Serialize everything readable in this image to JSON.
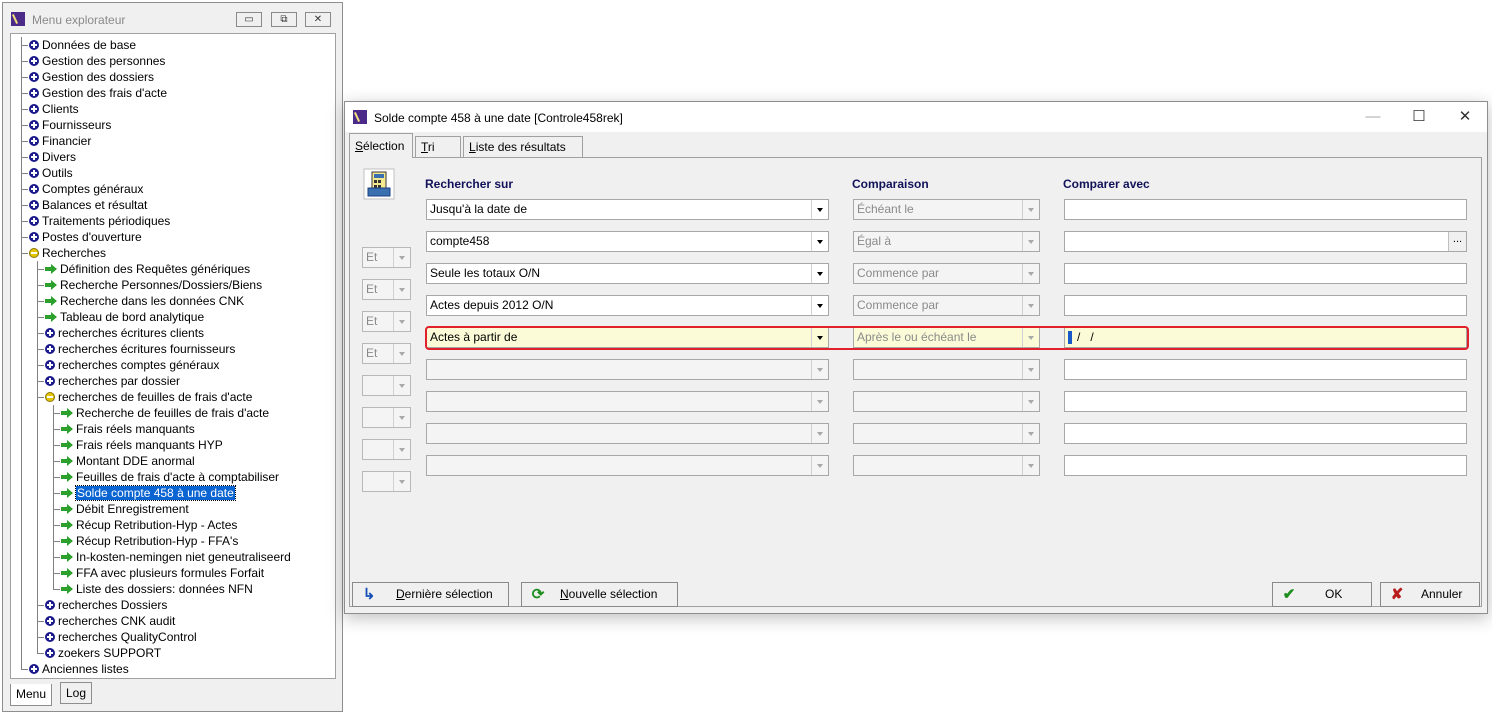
{
  "explorer": {
    "title": "Menu explorateur",
    "controls": {
      "minimize": "▭",
      "restore": "⧉",
      "close": "✕"
    },
    "tree": [
      {
        "label": "Données de base",
        "icon": "plus",
        "level": 0
      },
      {
        "label": "Gestion des personnes",
        "icon": "plus",
        "level": 0
      },
      {
        "label": "Gestion des dossiers",
        "icon": "plus",
        "level": 0
      },
      {
        "label": "Gestion des frais d'acte",
        "icon": "plus",
        "level": 0
      },
      {
        "label": "Clients",
        "icon": "plus",
        "level": 0
      },
      {
        "label": "Fournisseurs",
        "icon": "plus",
        "level": 0
      },
      {
        "label": "Financier",
        "icon": "plus",
        "level": 0
      },
      {
        "label": "Divers",
        "icon": "plus",
        "level": 0
      },
      {
        "label": "Outils",
        "icon": "plus",
        "level": 0
      },
      {
        "label": "Comptes généraux",
        "icon": "plus",
        "level": 0
      },
      {
        "label": "Balances et résultat",
        "icon": "plus",
        "level": 0
      },
      {
        "label": "Traitements périodiques",
        "icon": "plus",
        "level": 0
      },
      {
        "label": "Postes d'ouverture",
        "icon": "plus",
        "level": 0
      },
      {
        "label": "Recherches",
        "icon": "minus",
        "level": 0
      },
      {
        "label": "Définition des Requêtes génériques",
        "icon": "arrow",
        "level": 1
      },
      {
        "label": "Recherche Personnes/Dossiers/Biens",
        "icon": "arrow",
        "level": 1
      },
      {
        "label": "Recherche dans les données CNK",
        "icon": "arrow",
        "level": 1
      },
      {
        "label": "Tableau de bord analytique",
        "icon": "arrow",
        "level": 1
      },
      {
        "label": "recherches écritures clients",
        "icon": "plus",
        "level": 1
      },
      {
        "label": "recherches écritures fournisseurs",
        "icon": "plus",
        "level": 1
      },
      {
        "label": "recherches comptes généraux",
        "icon": "plus",
        "level": 1
      },
      {
        "label": "recherches par dossier",
        "icon": "plus",
        "level": 1
      },
      {
        "label": "recherches de feuilles de frais d'acte",
        "icon": "minus",
        "level": 1
      },
      {
        "label": "Recherche de feuilles de frais d'acte",
        "icon": "arrow",
        "level": 2
      },
      {
        "label": "Frais réels manquants",
        "icon": "arrow",
        "level": 2
      },
      {
        "label": "Frais réels manquants HYP",
        "icon": "arrow",
        "level": 2
      },
      {
        "label": "Montant DDE anormal",
        "icon": "arrow",
        "level": 2
      },
      {
        "label": "Feuilles de frais d'acte à comptabiliser",
        "icon": "arrow",
        "level": 2
      },
      {
        "label": "Solde compte 458 à une date",
        "icon": "arrow",
        "level": 2,
        "selected": true
      },
      {
        "label": "Débit Enregistrement",
        "icon": "arrow",
        "level": 2
      },
      {
        "label": "Récup Retribution-Hyp - Actes",
        "icon": "arrow",
        "level": 2
      },
      {
        "label": "Récup Retribution-Hyp - FFA's",
        "icon": "arrow",
        "level": 2
      },
      {
        "label": "In-kosten-nemingen niet geneutraliseerd",
        "icon": "arrow",
        "level": 2
      },
      {
        "label": "FFA avec plusieurs formules Forfait",
        "icon": "arrow",
        "level": 2
      },
      {
        "label": "Liste des dossiers: données NFN",
        "icon": "arrow",
        "level": 2
      },
      {
        "label": "recherches Dossiers",
        "icon": "plus",
        "level": 1
      },
      {
        "label": "recherches CNK audit",
        "icon": "plus",
        "level": 1
      },
      {
        "label": "recherches QualityControl",
        "icon": "plus",
        "level": 1
      },
      {
        "label": "zoekers SUPPORT",
        "icon": "plus",
        "level": 1
      },
      {
        "label": "Anciennes listes",
        "icon": "plus",
        "level": 0
      }
    ],
    "bottom_tabs": [
      "Menu",
      "Log"
    ]
  },
  "dialog": {
    "title": "Solde compte 458 à une date [Controle458rek]",
    "controls": {
      "minimize": "—",
      "maximize": "☐",
      "close": "✕"
    },
    "tabs": [
      {
        "first": "S",
        "rest": "élection"
      },
      {
        "first": "T",
        "rest": "ri"
      },
      {
        "first": "L",
        "rest": "iste des résultats"
      }
    ],
    "headers": {
      "search_on": "Rechercher sur",
      "comparison": "Comparaison",
      "compare_with": "Comparer avec"
    },
    "rows": [
      {
        "andor": "",
        "field": "Jusqu'à la date de",
        "comparison": "Échéant le",
        "value": ""
      },
      {
        "andor": "Et",
        "field": "compte458",
        "comparison": "Égal à",
        "value": "",
        "ellipsis": "..."
      },
      {
        "andor": "Et",
        "field": "Seule les totaux O/N",
        "comparison": "Commence par",
        "value": ""
      },
      {
        "andor": "Et",
        "field": "Actes depuis 2012 O/N",
        "comparison": "Commence par",
        "value": ""
      },
      {
        "andor": "Et",
        "field": "Actes à partir de",
        "comparison": "Après le ou échéant le",
        "value": "/   /",
        "highlight": true
      },
      {
        "andor": "",
        "field": "",
        "comparison": "",
        "value": ""
      },
      {
        "andor": "",
        "field": "",
        "comparison": "",
        "value": ""
      },
      {
        "andor": "",
        "field": "",
        "comparison": "",
        "value": ""
      },
      {
        "andor": "",
        "field": "",
        "comparison": "",
        "value": ""
      }
    ],
    "buttons": {
      "last_selection": {
        "first": "D",
        "rest": "ernière sélection"
      },
      "new_selection": {
        "first": "N",
        "rest": "ouvelle sélection"
      },
      "ok": "OK",
      "cancel": "Annuler"
    },
    "colors": {
      "highlight_border": "#e0202a",
      "highlight_fill": "#fbfbd8",
      "header_text": "#12125a"
    }
  }
}
